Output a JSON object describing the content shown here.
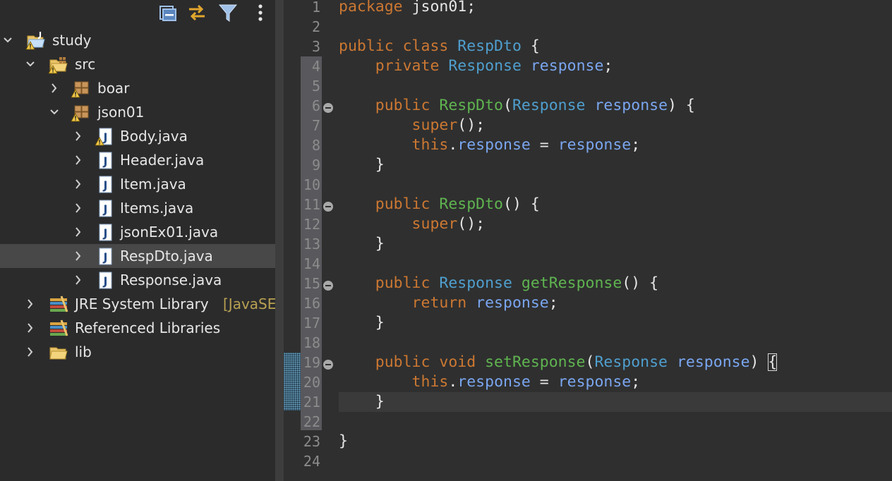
{
  "explorer": {
    "toolbar": {
      "icons": [
        "collapse-all-icon",
        "link-with-editor-icon",
        "filter-icon",
        "more-options-icon"
      ]
    },
    "tree": [
      {
        "label": "study",
        "icon": "java-project-icon",
        "expanded": true,
        "depth": 0,
        "warning": true
      },
      {
        "label": "src",
        "icon": "source-folder-icon",
        "expanded": true,
        "depth": 1,
        "warning": true
      },
      {
        "label": "boar",
        "icon": "package-icon",
        "expanded": false,
        "depth": 2,
        "warning": true
      },
      {
        "label": "json01",
        "icon": "package-icon",
        "expanded": true,
        "depth": 2,
        "warning": true
      },
      {
        "label": "Body.java",
        "icon": "java-file-icon",
        "expanded": false,
        "depth": 3,
        "warning": true
      },
      {
        "label": "Header.java",
        "icon": "java-file-icon",
        "expanded": false,
        "depth": 3
      },
      {
        "label": "Item.java",
        "icon": "java-file-icon",
        "expanded": false,
        "depth": 3
      },
      {
        "label": "Items.java",
        "icon": "java-file-icon",
        "expanded": false,
        "depth": 3
      },
      {
        "label": "jsonEx01.java",
        "icon": "java-file-icon",
        "expanded": false,
        "depth": 3
      },
      {
        "label": "RespDto.java",
        "icon": "java-file-icon",
        "expanded": false,
        "depth": 3,
        "selected": true
      },
      {
        "label": "Response.java",
        "icon": "java-file-icon",
        "expanded": false,
        "depth": 3
      },
      {
        "label": "JRE System Library",
        "decoration": "[JavaSE",
        "icon": "library-icon",
        "expanded": false,
        "depth": 1
      },
      {
        "label": "Referenced Libraries",
        "icon": "library-icon",
        "expanded": false,
        "depth": 1
      },
      {
        "label": "lib",
        "icon": "folder-icon",
        "expanded": false,
        "depth": 1
      }
    ]
  },
  "editor": {
    "file": "RespDto.java",
    "fold_lines": [
      6,
      11,
      15,
      19
    ],
    "current_line": 21,
    "line_numbers": [
      "1",
      "2",
      "3",
      "4",
      "5",
      "6",
      "7",
      "8",
      "9",
      "10",
      "11",
      "12",
      "13",
      "14",
      "15",
      "16",
      "17",
      "18",
      "19",
      "20",
      "21",
      "22",
      "23",
      "24"
    ],
    "lines": [
      [
        {
          "t": "package ",
          "c": "kw"
        },
        {
          "t": "json01;",
          "c": "pl"
        }
      ],
      [],
      [
        {
          "t": "public class ",
          "c": "kw"
        },
        {
          "t": "RespDto",
          "c": "ty"
        },
        {
          "t": " {",
          "c": "pl"
        }
      ],
      [
        {
          "t": "    private ",
          "c": "kw"
        },
        {
          "t": "Response",
          "c": "ty"
        },
        {
          "t": " ",
          "c": "pl"
        },
        {
          "t": "response",
          "c": "fd"
        },
        {
          "t": ";",
          "c": "pl"
        }
      ],
      [],
      [
        {
          "t": "    public ",
          "c": "kw"
        },
        {
          "t": "RespDto",
          "c": "fn"
        },
        {
          "t": "(",
          "c": "pl"
        },
        {
          "t": "Response",
          "c": "ty"
        },
        {
          "t": " ",
          "c": "pl"
        },
        {
          "t": "response",
          "c": "fd"
        },
        {
          "t": ") {",
          "c": "pl"
        }
      ],
      [
        {
          "t": "        super",
          "c": "kw"
        },
        {
          "t": "();",
          "c": "pl"
        }
      ],
      [
        {
          "t": "        this",
          "c": "kw"
        },
        {
          "t": ".",
          "c": "pl"
        },
        {
          "t": "response",
          "c": "fd"
        },
        {
          "t": " = ",
          "c": "pl"
        },
        {
          "t": "response",
          "c": "fd"
        },
        {
          "t": ";",
          "c": "pl"
        }
      ],
      [
        {
          "t": "    }",
          "c": "pl"
        }
      ],
      [],
      [
        {
          "t": "    public ",
          "c": "kw"
        },
        {
          "t": "RespDto",
          "c": "fn"
        },
        {
          "t": "() {",
          "c": "pl"
        }
      ],
      [
        {
          "t": "        super",
          "c": "kw"
        },
        {
          "t": "();",
          "c": "pl"
        }
      ],
      [
        {
          "t": "    }",
          "c": "pl"
        }
      ],
      [],
      [
        {
          "t": "    public ",
          "c": "kw"
        },
        {
          "t": "Response",
          "c": "ty"
        },
        {
          "t": " ",
          "c": "pl"
        },
        {
          "t": "getResponse",
          "c": "fn"
        },
        {
          "t": "() {",
          "c": "pl"
        }
      ],
      [
        {
          "t": "        return ",
          "c": "kw"
        },
        {
          "t": "response",
          "c": "fd"
        },
        {
          "t": ";",
          "c": "pl"
        }
      ],
      [
        {
          "t": "    }",
          "c": "pl"
        }
      ],
      [],
      [
        {
          "t": "    public void ",
          "c": "kw"
        },
        {
          "t": "setResponse",
          "c": "fn"
        },
        {
          "t": "(",
          "c": "pl"
        },
        {
          "t": "Response",
          "c": "ty"
        },
        {
          "t": " ",
          "c": "pl"
        },
        {
          "t": "response",
          "c": "fd"
        },
        {
          "t": ") ",
          "c": "pl"
        },
        {
          "t": "{",
          "c": "br"
        }
      ],
      [
        {
          "t": "        this",
          "c": "kw"
        },
        {
          "t": ".",
          "c": "pl"
        },
        {
          "t": "response",
          "c": "fd"
        },
        {
          "t": " = ",
          "c": "pl"
        },
        {
          "t": "response",
          "c": "fd"
        },
        {
          "t": ";",
          "c": "pl"
        }
      ],
      [
        {
          "t": "    }",
          "c": "pl"
        }
      ],
      [],
      [
        {
          "t": "}",
          "c": "pl"
        }
      ],
      []
    ]
  }
}
